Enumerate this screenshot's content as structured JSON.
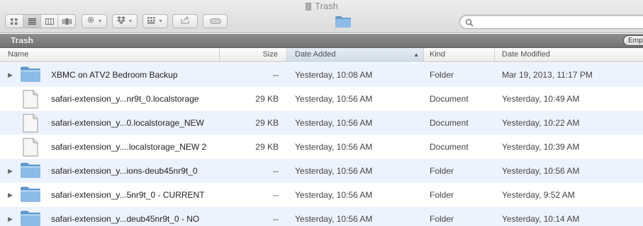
{
  "window": {
    "title": "Trash"
  },
  "toolbar": {
    "view_buttons": [
      {
        "name": "icon-view-icon"
      },
      {
        "name": "list-view-icon"
      },
      {
        "name": "column-view-icon"
      },
      {
        "name": "cover-flow-icon"
      }
    ],
    "action_icon": "gear-icon",
    "share_icon": "dropbox-icon",
    "arrange_icon": "arrange-grid-icon",
    "colors": {
      "folder": "#7fb0dc",
      "folder_dark": "#5f95c8"
    }
  },
  "pathbar": {
    "label": "Trash",
    "empty_button": "Empty"
  },
  "columns": {
    "name": "Name",
    "size": "Size",
    "date_added": "Date Added",
    "kind": "Kind",
    "date_modified": "Date Modified"
  },
  "rows": [
    {
      "type": "folder",
      "name": "XBMC on ATV2 Bedroom Backup",
      "size": "--",
      "date_added": "Yesterday, 10:08 AM",
      "kind": "Folder",
      "date_modified": "Mar 19, 2013, 11:17 PM"
    },
    {
      "type": "document",
      "name": "safari-extension_y...nr9t_0.localstorage",
      "size": "29 KB",
      "date_added": "Yesterday, 10:56 AM",
      "kind": "Document",
      "date_modified": "Yesterday, 10:49 AM"
    },
    {
      "type": "document",
      "name": "safari-extension_y...0.localstorage_NEW",
      "size": "29 KB",
      "date_added": "Yesterday, 10:56 AM",
      "kind": "Document",
      "date_modified": "Yesterday, 10:22 AM"
    },
    {
      "type": "document",
      "name": "safari-extension_y....localstorage_NEW 2",
      "size": "29 KB",
      "date_added": "Yesterday, 10:56 AM",
      "kind": "Document",
      "date_modified": "Yesterday, 10:39 AM"
    },
    {
      "type": "folder",
      "name": "safari-extension_y...ions-deub45nr9t_0",
      "size": "--",
      "date_added": "Yesterday, 10:56 AM",
      "kind": "Folder",
      "date_modified": "Yesterday, 10:56 AM"
    },
    {
      "type": "folder",
      "name": "safari-extension_y...5nr9t_0 - CURRENT",
      "size": "--",
      "date_added": "Yesterday, 10:56 AM",
      "kind": "Folder",
      "date_modified": "Yesterday, 9:52 AM"
    },
    {
      "type": "folder",
      "name": "safari-extension_y...deub45nr9t_0 - NO",
      "size": "--",
      "date_added": "Yesterday, 10:56 AM",
      "kind": "Folder",
      "date_modified": "Yesterday, 10:14 AM"
    }
  ]
}
